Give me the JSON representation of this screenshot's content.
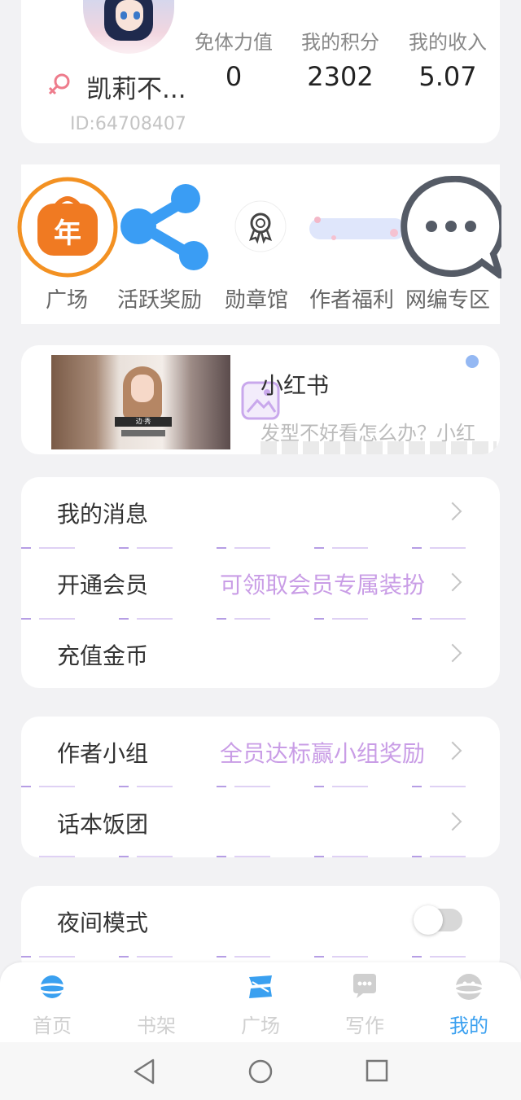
{
  "profile": {
    "nickname": "凯莉不...",
    "user_id": "ID:64708407",
    "stats": [
      {
        "label": "免体力值",
        "value": "0"
      },
      {
        "label": "我的积分",
        "value": "2302"
      },
      {
        "label": "我的收入",
        "value": "5.07"
      }
    ]
  },
  "shortcuts": [
    {
      "label": "广场",
      "icon": "new-year-bag-icon"
    },
    {
      "label": "活跃奖励",
      "icon": "share-icon"
    },
    {
      "label": "勋章馆",
      "icon": "medal-icon"
    },
    {
      "label": "作者福利",
      "icon": "banner-image-icon"
    },
    {
      "label": "网编专区",
      "icon": "chat-bubble-icon"
    }
  ],
  "ad": {
    "title": "小红书",
    "description": "发型不好看怎么办？小红",
    "badge_text": "边·秀"
  },
  "menu1": [
    {
      "label": "我的消息",
      "hint": ""
    },
    {
      "label": "开通会员",
      "hint": "可领取会员专属装扮"
    },
    {
      "label": "充值金币",
      "hint": ""
    }
  ],
  "menu2": [
    {
      "label": "作者小组",
      "hint": "全员达标赢小组奖励"
    },
    {
      "label": "话本饭团",
      "hint": ""
    }
  ],
  "menu3": [
    {
      "label": "夜间模式",
      "toggle_on": false
    }
  ],
  "bottom_nav": [
    {
      "label": "首页",
      "icon": "planet-icon"
    },
    {
      "label": "书架",
      "icon": "bookshelf-icon"
    },
    {
      "label": "广场",
      "icon": "square-icon"
    },
    {
      "label": "写作",
      "icon": "write-icon"
    },
    {
      "label": "我的",
      "icon": "profile-icon",
      "active": true
    }
  ],
  "colors": {
    "accent_blue": "#3aa0f0",
    "hint_purple": "#c99de6",
    "orange": "#f07a22"
  }
}
